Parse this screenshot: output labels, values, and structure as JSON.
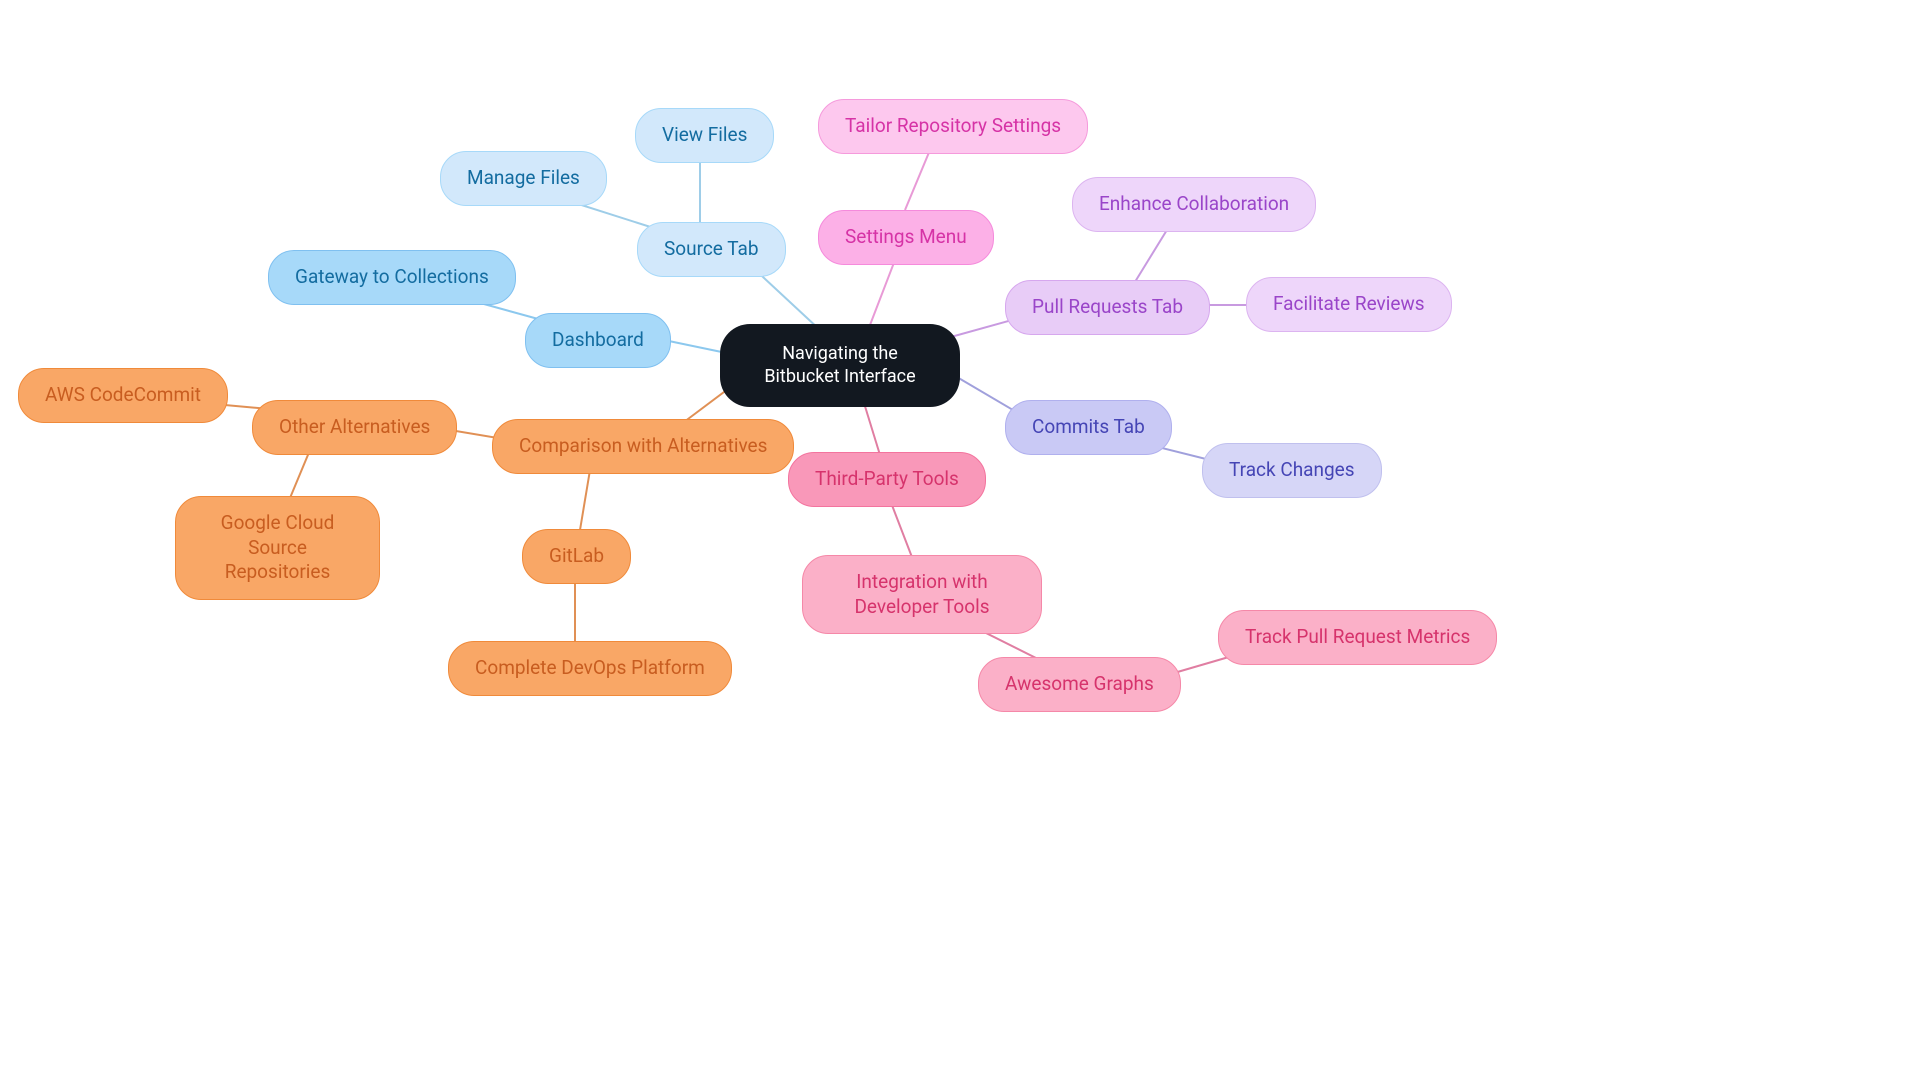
{
  "root": {
    "label": "Navigating the Bitbucket Interface"
  },
  "dashboard": {
    "label": "Dashboard",
    "children": {
      "gateway": "Gateway to Collections"
    }
  },
  "source_tab": {
    "label": "Source Tab",
    "children": {
      "view_files": "View Files",
      "manage_files": "Manage Files"
    }
  },
  "settings": {
    "label": "Settings Menu",
    "children": {
      "tailor": "Tailor Repository Settings"
    }
  },
  "pull_requests": {
    "label": "Pull Requests Tab",
    "children": {
      "enhance": "Enhance Collaboration",
      "reviews": "Facilitate Reviews"
    }
  },
  "commits": {
    "label": "Commits Tab",
    "children": {
      "track": "Track Changes"
    }
  },
  "third_party": {
    "label": "Third-Party Tools",
    "children": {
      "integration": "Integration with Developer Tools",
      "awesome": "Awesome Graphs",
      "metrics": "Track Pull Request Metrics"
    }
  },
  "comparison": {
    "label": "Comparison with Alternatives",
    "children": {
      "gitlab": "GitLab",
      "devops": "Complete DevOps Platform",
      "other_alt": "Other Alternatives",
      "aws": "AWS CodeCommit",
      "gcloud": "Google Cloud Source Repositories"
    }
  }
}
